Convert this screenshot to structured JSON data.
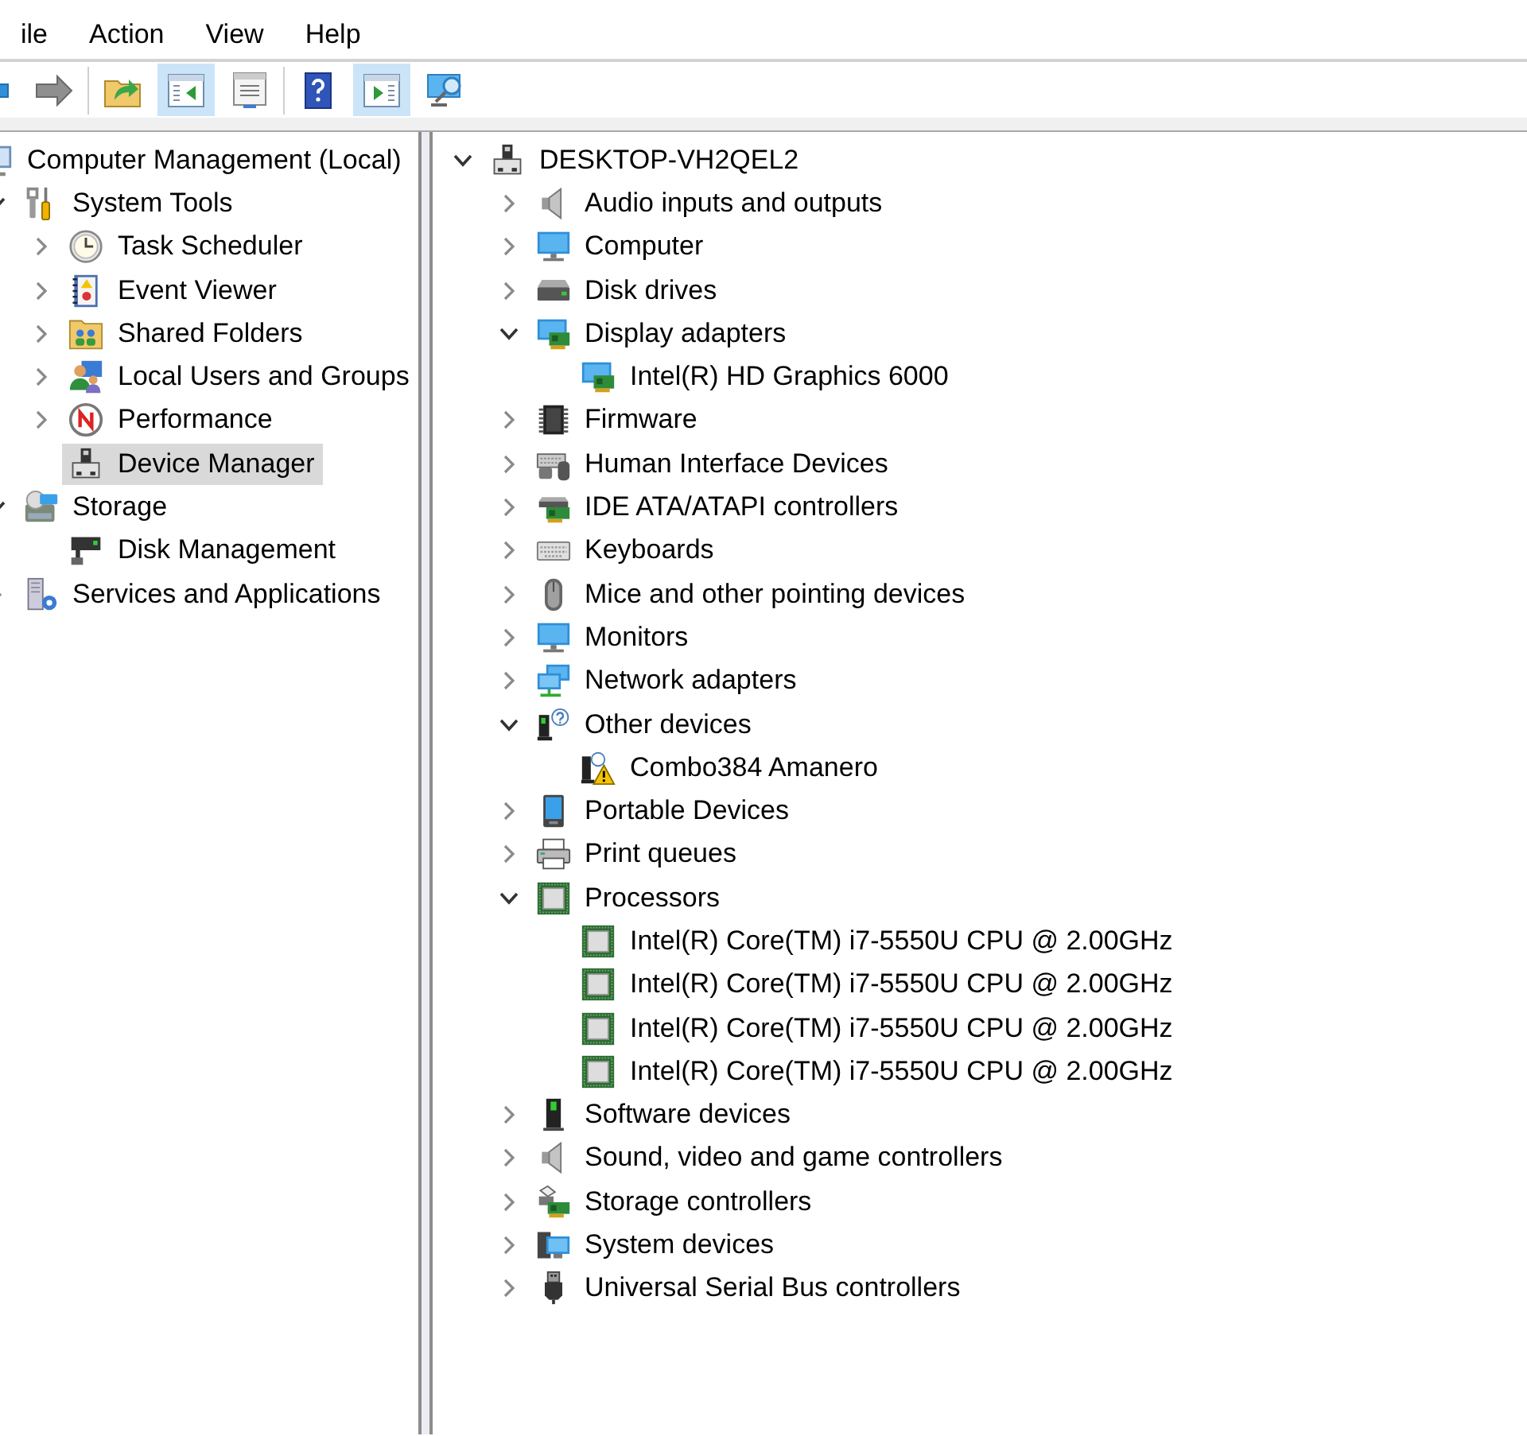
{
  "menu_bar": {
    "items": [
      "ile",
      "Action",
      "View",
      "Help"
    ]
  },
  "toolbar": {
    "groups": [
      [
        {
          "kind": "back",
          "pressed": false,
          "disabled": false
        },
        {
          "kind": "forward",
          "pressed": false,
          "disabled": true
        }
      ],
      [
        {
          "kind": "up",
          "pressed": false,
          "disabled": false
        },
        {
          "kind": "tree",
          "pressed": true,
          "disabled": false
        },
        {
          "kind": "properties",
          "pressed": false,
          "disabled": false
        }
      ],
      [
        {
          "kind": "help",
          "pressed": false,
          "disabled": false
        },
        {
          "kind": "actions",
          "pressed": true,
          "disabled": false
        },
        {
          "kind": "monitor",
          "pressed": false,
          "disabled": false
        }
      ]
    ]
  },
  "console_tree": {
    "items": [
      {
        "label": "Computer Management (Local)",
        "kind": "computer",
        "selected": false,
        "children": [
          {
            "label": "System Tools",
            "kind": "tools",
            "expanded": true,
            "selected": false,
            "children": [
              {
                "label": "Task Scheduler",
                "kind": "clock",
                "expanded": false,
                "selected": false
              },
              {
                "label": "Event Viewer",
                "kind": "eventlog",
                "expanded": false,
                "selected": false
              },
              {
                "label": "Shared Folders",
                "kind": "shared",
                "expanded": false,
                "selected": false
              },
              {
                "label": "Local Users and Groups",
                "kind": "users",
                "expanded": false,
                "selected": false
              },
              {
                "label": "Performance",
                "kind": "performance",
                "expanded": false,
                "selected": false
              },
              {
                "label": "Device Manager",
                "kind": "device",
                "selected": true
              }
            ]
          },
          {
            "label": "Storage",
            "kind": "storage",
            "expanded": true,
            "selected": false,
            "children": [
              {
                "label": "Disk Management",
                "kind": "disk",
                "selected": false
              }
            ]
          },
          {
            "label": "Services and Applications",
            "kind": "services",
            "expanded": false,
            "selected": false
          }
        ]
      }
    ]
  },
  "device_tree": {
    "items": [
      {
        "label": "DESKTOP-VH2QEL2",
        "kind": "device",
        "expanded": true,
        "children": [
          {
            "label": "Audio inputs and outputs",
            "kind": "speaker",
            "expanded": false
          },
          {
            "label": "Computer",
            "kind": "monitor",
            "expanded": false
          },
          {
            "label": "Disk drives",
            "kind": "drive",
            "expanded": false
          },
          {
            "label": "Display adapters",
            "kind": "adapter",
            "expanded": true,
            "children": [
              {
                "label": "Intel(R) HD Graphics 6000",
                "kind": "adapter"
              }
            ]
          },
          {
            "label": "Firmware",
            "kind": "firmware",
            "expanded": false
          },
          {
            "label": "Human Interface Devices",
            "kind": "hid",
            "expanded": false
          },
          {
            "label": "IDE ATA/ATAPI controllers",
            "kind": "ide",
            "expanded": false
          },
          {
            "label": "Keyboards",
            "kind": "keyboard",
            "expanded": false
          },
          {
            "label": "Mice and other pointing devices",
            "kind": "mouse",
            "expanded": false
          },
          {
            "label": "Monitors",
            "kind": "monitor",
            "expanded": false
          },
          {
            "label": "Network adapters",
            "kind": "network",
            "expanded": false
          },
          {
            "label": "Other devices",
            "kind": "unknown",
            "expanded": true,
            "children": [
              {
                "label": "Combo384 Amanero",
                "kind": "problem"
              }
            ]
          },
          {
            "label": "Portable Devices",
            "kind": "portable",
            "expanded": false
          },
          {
            "label": "Print queues",
            "kind": "printer",
            "expanded": false
          },
          {
            "label": "Processors",
            "kind": "processor",
            "expanded": true,
            "children": [
              {
                "label": "Intel(R) Core(TM) i7-5550U CPU @ 2.00GHz",
                "kind": "processor"
              },
              {
                "label": "Intel(R) Core(TM) i7-5550U CPU @ 2.00GHz",
                "kind": "processor"
              },
              {
                "label": "Intel(R) Core(TM) i7-5550U CPU @ 2.00GHz",
                "kind": "processor"
              },
              {
                "label": "Intel(R) Core(TM) i7-5550U CPU @ 2.00GHz",
                "kind": "processor"
              }
            ]
          },
          {
            "label": "Software devices",
            "kind": "software",
            "expanded": false
          },
          {
            "label": "Sound, video and game controllers",
            "kind": "speaker",
            "expanded": false
          },
          {
            "label": "Storage controllers",
            "kind": "storagectl",
            "expanded": false
          },
          {
            "label": "System devices",
            "kind": "system",
            "expanded": false
          },
          {
            "label": "Universal Serial Bus controllers",
            "kind": "usb",
            "expanded": false
          }
        ]
      }
    ]
  }
}
